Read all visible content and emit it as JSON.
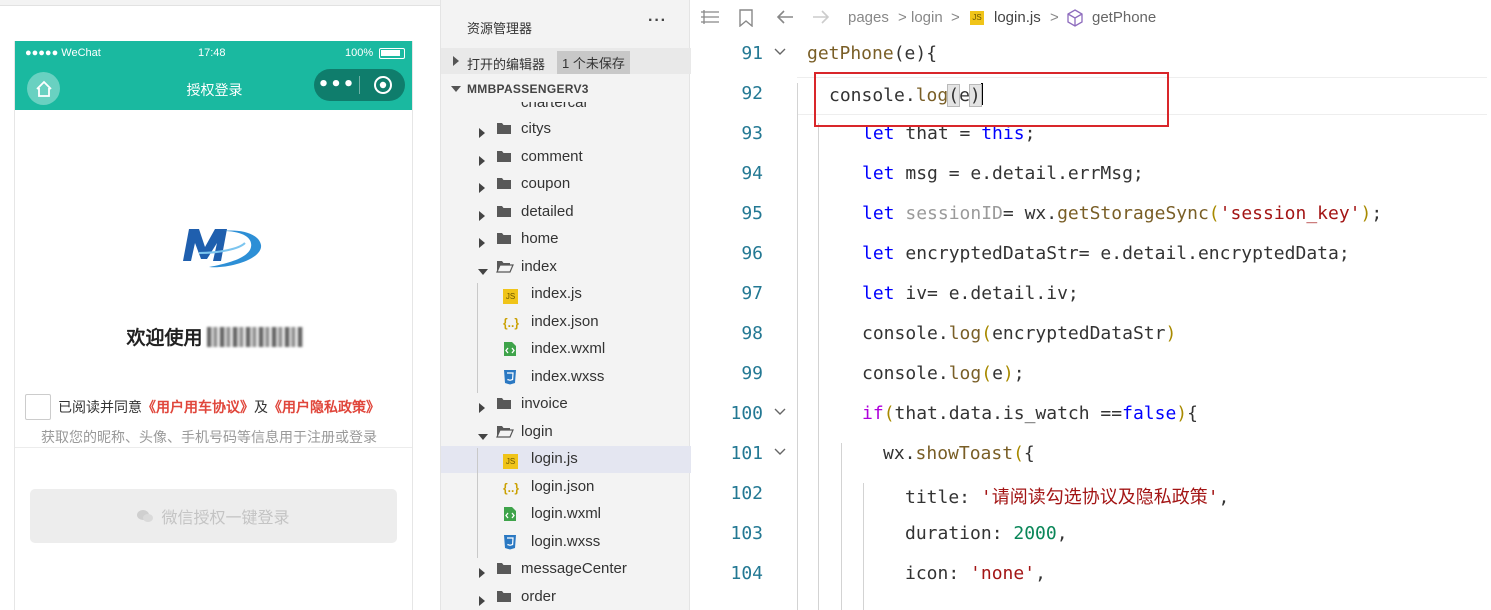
{
  "simulator": {
    "status": {
      "carrier": "●●●●● WeChat",
      "time": "17:48",
      "battery": "100%"
    },
    "nav_title": "授权登录",
    "capsule_more": "•••",
    "welcome_prefix": "欢迎使用",
    "agree_prefix": "已阅读并同意",
    "agree_link1": "《用户用车协议》",
    "agree_mid": "及",
    "agree_link2": "《用户隐私政策》",
    "info_text": "获取您的昵称、头像、手机号码等信息用于注册或登录",
    "login_button": "微信授权一键登录"
  },
  "explorer": {
    "title": "资源管理器",
    "more": "···",
    "open_editors": "打开的编辑器",
    "unsaved_badge": "1 个未保存",
    "project": "MMBPASSENGERV3",
    "partial_item": "chartercar",
    "items": [
      {
        "name": "citys",
        "type": "folder"
      },
      {
        "name": "comment",
        "type": "folder"
      },
      {
        "name": "coupon",
        "type": "folder"
      },
      {
        "name": "detailed",
        "type": "folder"
      },
      {
        "name": "home",
        "type": "folder"
      },
      {
        "name": "index",
        "type": "folder-open"
      },
      {
        "name": "index.js",
        "type": "js"
      },
      {
        "name": "index.json",
        "type": "json"
      },
      {
        "name": "index.wxml",
        "type": "wxml"
      },
      {
        "name": "index.wxss",
        "type": "wxss"
      },
      {
        "name": "invoice",
        "type": "folder"
      },
      {
        "name": "login",
        "type": "folder-open"
      },
      {
        "name": "login.js",
        "type": "js",
        "selected": true
      },
      {
        "name": "login.json",
        "type": "json"
      },
      {
        "name": "login.wxml",
        "type": "wxml"
      },
      {
        "name": "login.wxss",
        "type": "wxss"
      },
      {
        "name": "messageCenter",
        "type": "folder"
      },
      {
        "name": "order",
        "type": "folder"
      }
    ]
  },
  "breadcrumb": {
    "parts": [
      "pages",
      "login",
      "login.js",
      "getPhone"
    ],
    "sep": ">"
  },
  "code": {
    "lines": [
      {
        "num": "91",
        "tokens": [
          [
            "fn",
            "getPhone"
          ],
          [
            "plain",
            "("
          ],
          [
            "var",
            "e"
          ],
          [
            "plain",
            "){"
          ]
        ]
      },
      {
        "num": "92",
        "tokens": [
          [
            "plain",
            "console."
          ],
          [
            "fn",
            "log"
          ],
          [
            "hl",
            "("
          ],
          [
            "var",
            "e"
          ],
          [
            "hl",
            ")"
          ]
        ]
      },
      {
        "num": "93",
        "tokens": [
          [
            "kw",
            "let"
          ],
          [
            "plain",
            " that = "
          ],
          [
            "kw",
            "this"
          ],
          [
            "plain",
            ";"
          ]
        ]
      },
      {
        "num": "94",
        "tokens": [
          [
            "kw",
            "let"
          ],
          [
            "plain",
            " msg = e.detail.errMsg;"
          ]
        ]
      },
      {
        "num": "95",
        "tokens": [
          [
            "kw",
            "let"
          ],
          [
            "dim",
            " sessionID"
          ],
          [
            "plain",
            "= wx."
          ],
          [
            "fn",
            "getStorageSync"
          ],
          [
            "paren",
            "("
          ],
          [
            "str",
            "'session_key'"
          ],
          [
            "paren",
            ")"
          ],
          [
            "plain",
            ";"
          ]
        ]
      },
      {
        "num": "96",
        "tokens": [
          [
            "kw",
            "let"
          ],
          [
            "plain",
            " encryptedDataStr= e.detail.encryptedData;"
          ]
        ]
      },
      {
        "num": "97",
        "tokens": [
          [
            "kw",
            "let"
          ],
          [
            "plain",
            " iv= e.detail.iv;"
          ]
        ]
      },
      {
        "num": "98",
        "tokens": [
          [
            "plain",
            "console."
          ],
          [
            "fn",
            "log"
          ],
          [
            "paren",
            "("
          ],
          [
            "plain",
            "encryptedDataStr"
          ],
          [
            "paren",
            ")"
          ]
        ]
      },
      {
        "num": "99",
        "tokens": [
          [
            "plain",
            "console."
          ],
          [
            "fn",
            "log"
          ],
          [
            "paren",
            "("
          ],
          [
            "plain",
            "e"
          ],
          [
            "paren",
            ")"
          ],
          [
            "plain",
            ";"
          ]
        ]
      },
      {
        "num": "100",
        "tokens": [
          [
            "ctl",
            "if"
          ],
          [
            "paren",
            "("
          ],
          [
            "plain",
            "that.data.is_watch =="
          ],
          [
            "kw",
            "false"
          ],
          [
            "paren",
            ")"
          ],
          [
            "plain",
            "{"
          ]
        ]
      },
      {
        "num": "101",
        "tokens": [
          [
            "plain",
            "wx."
          ],
          [
            "fn",
            "showToast"
          ],
          [
            "paren",
            "("
          ],
          [
            "plain",
            "{"
          ]
        ]
      },
      {
        "num": "102",
        "tokens": [
          [
            "plain",
            "title: "
          ],
          [
            "str",
            "'请阅读勾选协议及隐私政策'"
          ],
          [
            "plain",
            ","
          ]
        ]
      },
      {
        "num": "103",
        "tokens": [
          [
            "plain",
            "duration: "
          ],
          [
            "num",
            "2000"
          ],
          [
            "plain",
            ","
          ]
        ]
      },
      {
        "num": "104",
        "tokens": [
          [
            "plain",
            "icon: "
          ],
          [
            "str",
            "'none'"
          ],
          [
            "plain",
            ","
          ]
        ]
      }
    ]
  },
  "colors": {
    "accent": "#1ab9a0",
    "capsule": "#0f7d6c",
    "link": "#e0463b",
    "highlight": "#d9262a"
  }
}
